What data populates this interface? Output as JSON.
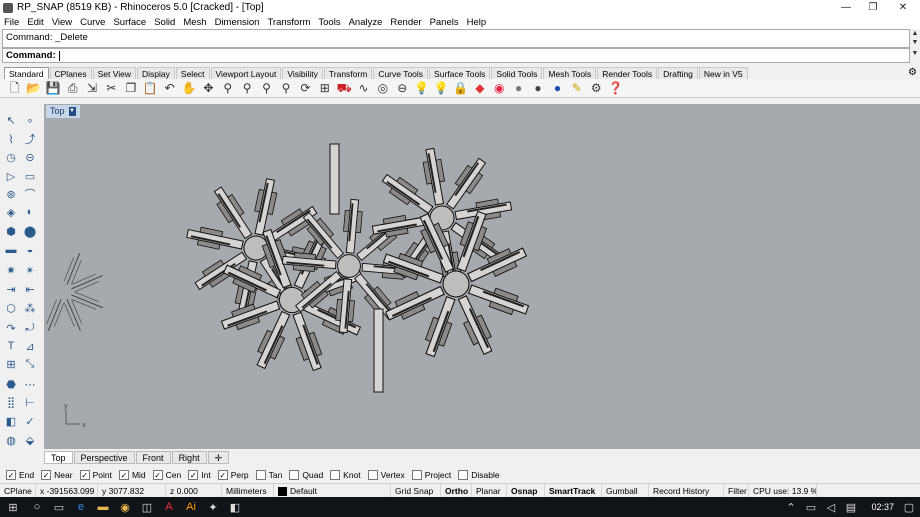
{
  "window": {
    "title": "RP_SNAP (8519 KB) - Rhinoceros 5.0 [Cracked] - [Top]",
    "controls": {
      "minimize": "—",
      "maximize": "❐",
      "close": "✕"
    }
  },
  "menu": [
    "File",
    "Edit",
    "View",
    "Curve",
    "Surface",
    "Solid",
    "Mesh",
    "Dimension",
    "Transform",
    "Tools",
    "Analyze",
    "Render",
    "Panels",
    "Help"
  ],
  "command": {
    "history": "Command: _Delete",
    "prompt": "Command:",
    "value": ""
  },
  "toolbar_tabs": [
    "Standard",
    "CPlanes",
    "Set View",
    "Display",
    "Select",
    "Viewport Layout",
    "Visibility",
    "Transform",
    "Curve Tools",
    "Surface Tools",
    "Solid Tools",
    "Mesh Tools",
    "Render Tools",
    "Drafting",
    "New in V5"
  ],
  "active_tab": "Standard",
  "toolbar_icons": [
    "new-icon",
    "open-icon",
    "save-icon",
    "print-icon",
    "import-icon",
    "cut-icon",
    "copy-icon",
    "paste-icon",
    "undo-icon",
    "pan-icon",
    "move-icon",
    "zoom-icon",
    "zoom-window-icon",
    "zoom-extents-icon",
    "zoom-selected-icon",
    "rotate-view-icon",
    "four-viewports-icon",
    "car-icon",
    "snake-icon",
    "point-icon",
    "ellipse-icon",
    "lightbulb-icon",
    "lock-icon",
    "color-icon",
    "palette-icon",
    "shade-icon",
    "render-icon",
    "material-icon",
    "light-icon",
    "tools-icon",
    "help-icon"
  ],
  "viewport": {
    "label": "Top",
    "background": "#a6aaae"
  },
  "view_tabs": [
    "Top",
    "Perspective",
    "Front",
    "Right"
  ],
  "active_view": "Top",
  "add_view_tab": "✛",
  "osnaps": [
    {
      "label": "End",
      "checked": true
    },
    {
      "label": "Near",
      "checked": true
    },
    {
      "label": "Point",
      "checked": true
    },
    {
      "label": "Mid",
      "checked": true
    },
    {
      "label": "Cen",
      "checked": true
    },
    {
      "label": "Int",
      "checked": true
    },
    {
      "label": "Perp",
      "checked": true
    },
    {
      "label": "Tan",
      "checked": false
    },
    {
      "label": "Quad",
      "checked": false
    },
    {
      "label": "Knot",
      "checked": false
    },
    {
      "label": "Vertex",
      "checked": false
    },
    {
      "label": "Project",
      "checked": false
    },
    {
      "label": "Disable",
      "checked": false
    }
  ],
  "status": {
    "cplane": "CPlane",
    "x": "x -391563.099",
    "y": "y 3077.832",
    "z": "z 0.000",
    "units": "Millimeters",
    "layer": "Default",
    "grid_snap": "Grid Snap",
    "ortho": "Ortho",
    "planar": "Planar",
    "osnap": "Osnap",
    "smarttrack": "SmartTrack",
    "gumball": "Gumball",
    "record_history": "Record History",
    "filter": "Filter",
    "cpu": "CPU use: 13.9 %"
  },
  "taskbar": {
    "clock": "02:37"
  }
}
